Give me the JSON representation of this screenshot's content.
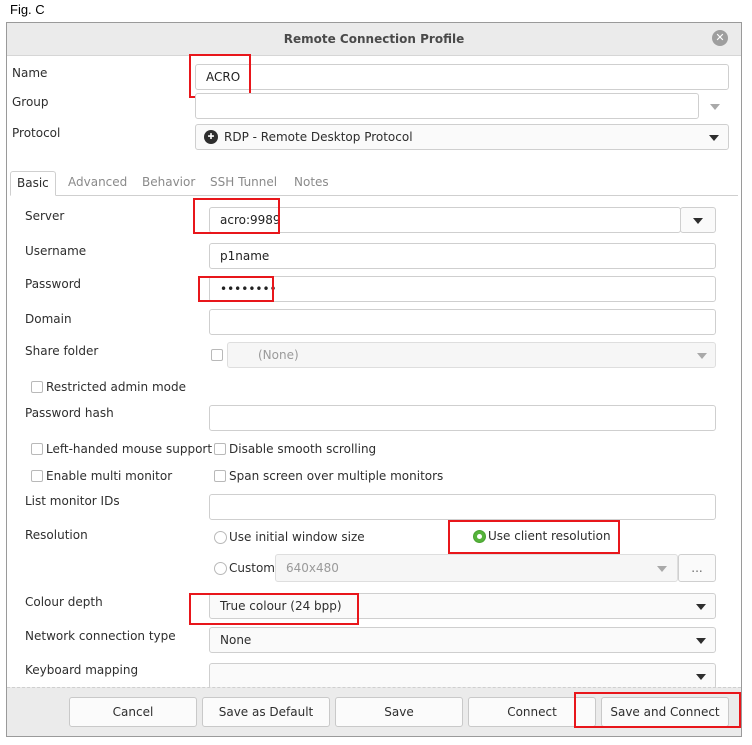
{
  "figure_label": "Fig. C",
  "window": {
    "title": "Remote Connection Profile"
  },
  "profile": {
    "name_label": "Name",
    "name_value": "ACRO",
    "group_label": "Group",
    "group_value": "",
    "protocol_label": "Protocol",
    "protocol_value": "RDP - Remote Desktop Protocol"
  },
  "tabs": [
    {
      "label": "Basic",
      "active": true
    },
    {
      "label": "Advanced",
      "active": false
    },
    {
      "label": "Behavior",
      "active": false
    },
    {
      "label": "SSH Tunnel",
      "active": false
    },
    {
      "label": "Notes",
      "active": false
    }
  ],
  "basic": {
    "server_label": "Server",
    "server_value": "acro:9989",
    "username_label": "Username",
    "username_value": "p1name",
    "password_label": "Password",
    "password_value": "••••••••",
    "domain_label": "Domain",
    "domain_value": "",
    "share_folder_label": "Share folder",
    "share_folder_value": "(None)",
    "restricted_admin_label": "Restricted admin mode",
    "password_hash_label": "Password hash",
    "password_hash_value": "",
    "left_handed_label": "Left-handed mouse support",
    "disable_smooth_label": "Disable smooth scrolling",
    "multi_monitor_label": "Enable multi monitor",
    "span_screen_label": "Span screen over multiple monitors",
    "monitor_ids_label": "List monitor IDs",
    "monitor_ids_value": "",
    "resolution_label": "Resolution",
    "res_initial_label": "Use initial window size",
    "res_client_label": "Use client resolution",
    "res_custom_label": "Custom",
    "res_custom_value": "640x480",
    "res_more_label": "...",
    "colour_depth_label": "Colour depth",
    "colour_depth_value": "True colour (24 bpp)",
    "network_label": "Network connection type",
    "network_value": "None",
    "keyboard_label": "Keyboard mapping",
    "keyboard_value": ""
  },
  "buttons": {
    "cancel": "Cancel",
    "save_default": "Save as Default",
    "save": "Save",
    "connect": "Connect",
    "save_connect": "Save and Connect"
  },
  "colors": {
    "highlight": "#e8161b",
    "radio_selected": "#55b33a",
    "titlebar": "#ebebeb"
  }
}
